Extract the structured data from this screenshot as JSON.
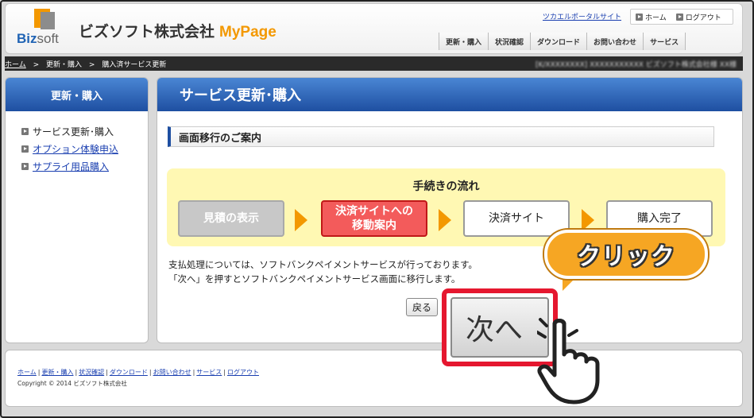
{
  "header": {
    "brand_main": "Biz",
    "brand_sub": "soft",
    "company": "ビズソフト株式会社",
    "mypage": "MyPage",
    "portal_link": "ツカエルポータルサイト",
    "util": [
      {
        "label": "ホーム"
      },
      {
        "label": "ログアウト"
      }
    ],
    "nav": [
      {
        "label": "更新・購入"
      },
      {
        "label": "状況確認"
      },
      {
        "label": "ダウンロード"
      },
      {
        "label": "お問い合わせ"
      },
      {
        "label": "サービス"
      }
    ]
  },
  "breadcrumb": {
    "home": "ホーム",
    "sep": ">",
    "level1": "更新・購入",
    "level2": "購入済サービス更新",
    "user_info": "[K/XXXXXXXX]  XXXXXXXXXXX ビズソフト株式会社様 XX様"
  },
  "sidebar": {
    "title": "更新・購入",
    "items": [
      {
        "label": "サービス更新･購入"
      },
      {
        "label": "オプション体験申込"
      },
      {
        "label": "サプライ用品購入"
      }
    ]
  },
  "main": {
    "title": "サービス更新･購入",
    "section_title": "画面移行のご案内",
    "flow_title": "手続きの流れ",
    "steps": [
      {
        "label": "見積の表示"
      },
      {
        "label": "決済サイトへの移動案内"
      },
      {
        "label": "決済サイト"
      },
      {
        "label": "購入完了"
      }
    ],
    "desc_line1": "支払処理については、ソフトバンクペイメントサービスが行っております。",
    "desc_line2": "「次へ」を押すとソフトバンクペイメントサービス画面に移行します。",
    "back_label": "戻る",
    "next_label": "次へ"
  },
  "overlay": {
    "click_label": "クリック"
  },
  "footer": {
    "links": [
      {
        "label": "ホーム"
      },
      {
        "label": "更新・購入"
      },
      {
        "label": "状況確認"
      },
      {
        "label": "ダウンロード"
      },
      {
        "label": "お問い合わせ"
      },
      {
        "label": "サービス"
      },
      {
        "label": "ログアウト"
      }
    ],
    "copyright": "Copyright © 2014 ビズソフト株式会社"
  },
  "colors": {
    "accent_blue": "#1e4fa1",
    "brand_orange": "#f39800",
    "highlight_red": "#e5172f"
  }
}
